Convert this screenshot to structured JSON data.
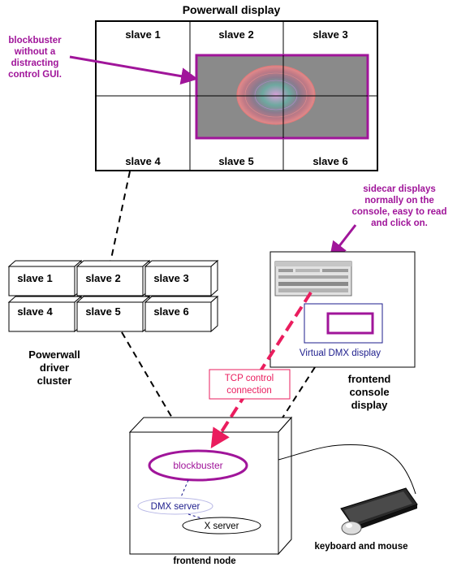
{
  "powerwall": {
    "title": "Powerwall display",
    "slaves": [
      "slave 1",
      "slave 2",
      "slave 3",
      "slave 4",
      "slave 5",
      "slave 6"
    ]
  },
  "annotations": {
    "blockbuster_note": [
      "blockbuster",
      "without a",
      "distracting",
      "control GUI."
    ],
    "sidecar_note": [
      "sidecar displays",
      "normally on the",
      "console, easy to read",
      "and click on."
    ]
  },
  "cluster": {
    "label": [
      "Powerwall",
      "driver",
      "cluster"
    ],
    "slaves": [
      "slave 1",
      "slave 2",
      "slave 3",
      "slave 4",
      "slave 5",
      "slave 6"
    ]
  },
  "console": {
    "virtual_dmx_label": "Virtual DMX display",
    "label": [
      "frontend",
      "console",
      "display"
    ]
  },
  "tcp": {
    "label": [
      "TCP control",
      "connection"
    ]
  },
  "frontend_node": {
    "blockbuster": "blockbuster",
    "dmx_server": "DMX server",
    "x_server": "X server",
    "label": "frontend node"
  },
  "keyboard": {
    "label": "keyboard and mouse"
  },
  "colors": {
    "purple": "#a0159a",
    "pink": "#ea1d5e",
    "navy": "#1c1c8c",
    "black": "#000000"
  }
}
